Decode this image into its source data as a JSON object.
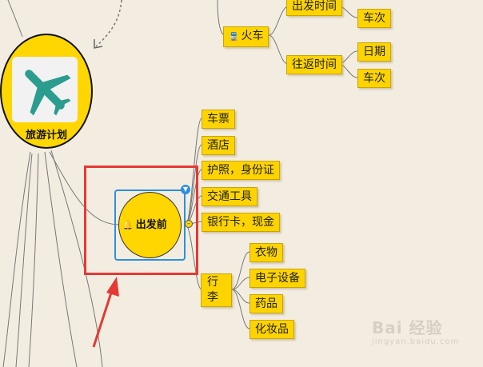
{
  "root": {
    "label": "旅游计划",
    "logo_icon": "airplane-icon"
  },
  "center_topic": {
    "label": "出发前",
    "icon": "bell-icon"
  },
  "before_departure_items": [
    {
      "label": "车票"
    },
    {
      "label": "酒店"
    },
    {
      "label": "护照，身份证"
    },
    {
      "label": "交通工具"
    },
    {
      "label": "银行卡，现金"
    }
  ],
  "luggage": {
    "label": "行李",
    "items": [
      {
        "label": "衣物"
      },
      {
        "label": "电子设备"
      },
      {
        "label": "药品"
      },
      {
        "label": "化妆品"
      }
    ]
  },
  "train": {
    "label": "火车",
    "icon": "train-icon",
    "departure_time": {
      "label": "出发时间",
      "children": [
        "车次"
      ]
    },
    "return_time": {
      "label": "往返时间",
      "children": [
        "日期",
        "车次"
      ]
    }
  },
  "watermark": {
    "text": "Bai 经验",
    "sub": "jingyan.baidu.com"
  },
  "colors": {
    "node_fill": "#fdd400",
    "selection": "#2b8fe0",
    "annotation": "#e53935",
    "background": "#f3ede1"
  }
}
